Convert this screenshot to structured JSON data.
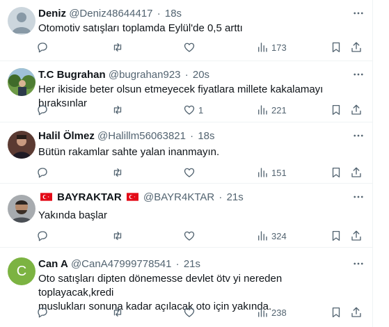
{
  "tweets": [
    {
      "name": "Deniz",
      "handle": "@Deniz48644417",
      "time": "18s",
      "text": "Otomotiv satışları  toplamda Eylül'de 0,5 arttı",
      "likes": "",
      "views": "173",
      "avatar_initial": "",
      "avatar_color": "#c9d3db"
    },
    {
      "name": "T.C Bugrahan",
      "handle": "@bugrahan923",
      "time": "20s",
      "text": "Her ikiside beter olsun etmeyecek fiyatlara millete kakalamayı bıraksınlar",
      "likes": "1",
      "views": "221",
      "avatar_initial": "",
      "avatar_color": "#5a8a3a"
    },
    {
      "name": "Halil Ölmez",
      "handle": "@Halillm56063821",
      "time": "18s",
      "text": "Bütün rakamlar sahte yalan inanmayın.",
      "likes": "",
      "views": "151",
      "avatar_initial": "",
      "avatar_color": "#3a2b2b"
    },
    {
      "name": "BAYRAKTAR",
      "handle": "@BAYR4KTAR",
      "time": "21s",
      "text": "Yakında başlar",
      "likes": "",
      "views": "324",
      "avatar_initial": "",
      "avatar_color": "#8a8f93"
    },
    {
      "name": "Can A",
      "handle": "@CanA47999778541",
      "time": "21s",
      "text_lines": [
        "Oto satışları dipten dönemesse devlet ötv yi nereden toplayacak,kredi",
        "muslukları sonuna kadar açılacak oto için yakında."
      ],
      "likes": "",
      "views": "238",
      "avatar_initial": "C",
      "avatar_color": "#7cb342"
    }
  ],
  "colors": {
    "text_primary": "#0f1419",
    "text_secondary": "#536471",
    "divider": "#eff3f4",
    "flag_red": "#e30a17"
  }
}
